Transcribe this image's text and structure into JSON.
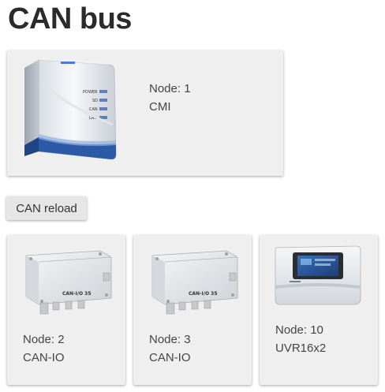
{
  "page": {
    "title": "CAN bus"
  },
  "main_device": {
    "node": "Node: 1",
    "name": "CMI",
    "leds": [
      "POWER",
      "SD",
      "CAN",
      "LAN"
    ]
  },
  "actions": {
    "reload_label": "CAN reload"
  },
  "devices": [
    {
      "node": "Node: 2",
      "name": "CAN-IO",
      "label": "CAN-I/O 35"
    },
    {
      "node": "Node: 3",
      "name": "CAN-IO",
      "label": "CAN-I/O 35"
    },
    {
      "node": "Node: 10",
      "name": "UVR16x2"
    }
  ],
  "colors": {
    "card_bg": "#efefef",
    "title": "#2b2b2b",
    "text": "#444444",
    "accent_blue": "#2d5aa6"
  }
}
